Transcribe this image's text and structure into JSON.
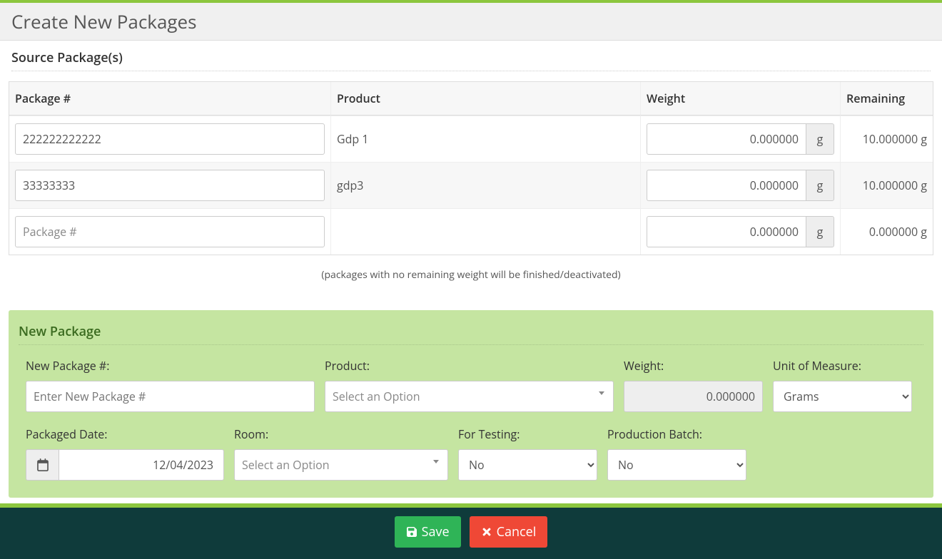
{
  "header": {
    "title": "Create New Packages"
  },
  "source": {
    "title": "Source Package(s)",
    "cols": {
      "pkg": "Package #",
      "product": "Product",
      "weight": "Weight",
      "remaining": "Remaining"
    },
    "placeholder_pkg": "Package #",
    "rows": [
      {
        "pkg": "222222222222",
        "product": "Gdp 1",
        "weight": "0.000000",
        "unit": "g",
        "remaining": "10.000000 g"
      },
      {
        "pkg": "33333333",
        "product": "gdp3",
        "weight": "0.000000",
        "unit": "g",
        "remaining": "10.000000 g"
      },
      {
        "pkg": "",
        "product": "",
        "weight": "0.000000",
        "unit": "g",
        "remaining": "0.000000 g"
      }
    ],
    "note": "(packages with no remaining weight will be finished/deactivated)"
  },
  "newpkg": {
    "title": "New Package",
    "labels": {
      "number": "New Package #:",
      "product": "Product:",
      "weight": "Weight:",
      "uom": "Unit of Measure:",
      "date": "Packaged Date:",
      "room": "Room:",
      "testing": "For Testing:",
      "batch": "Production Batch:"
    },
    "placeholders": {
      "number": "Enter New Package #",
      "product": "Select an Option",
      "room": "Select an Option"
    },
    "values": {
      "weight": "0.000000",
      "uom": "Grams",
      "date": "12/04/2023",
      "testing": "No",
      "batch": "No"
    }
  },
  "footer": {
    "save": "Save",
    "cancel": "Cancel"
  }
}
